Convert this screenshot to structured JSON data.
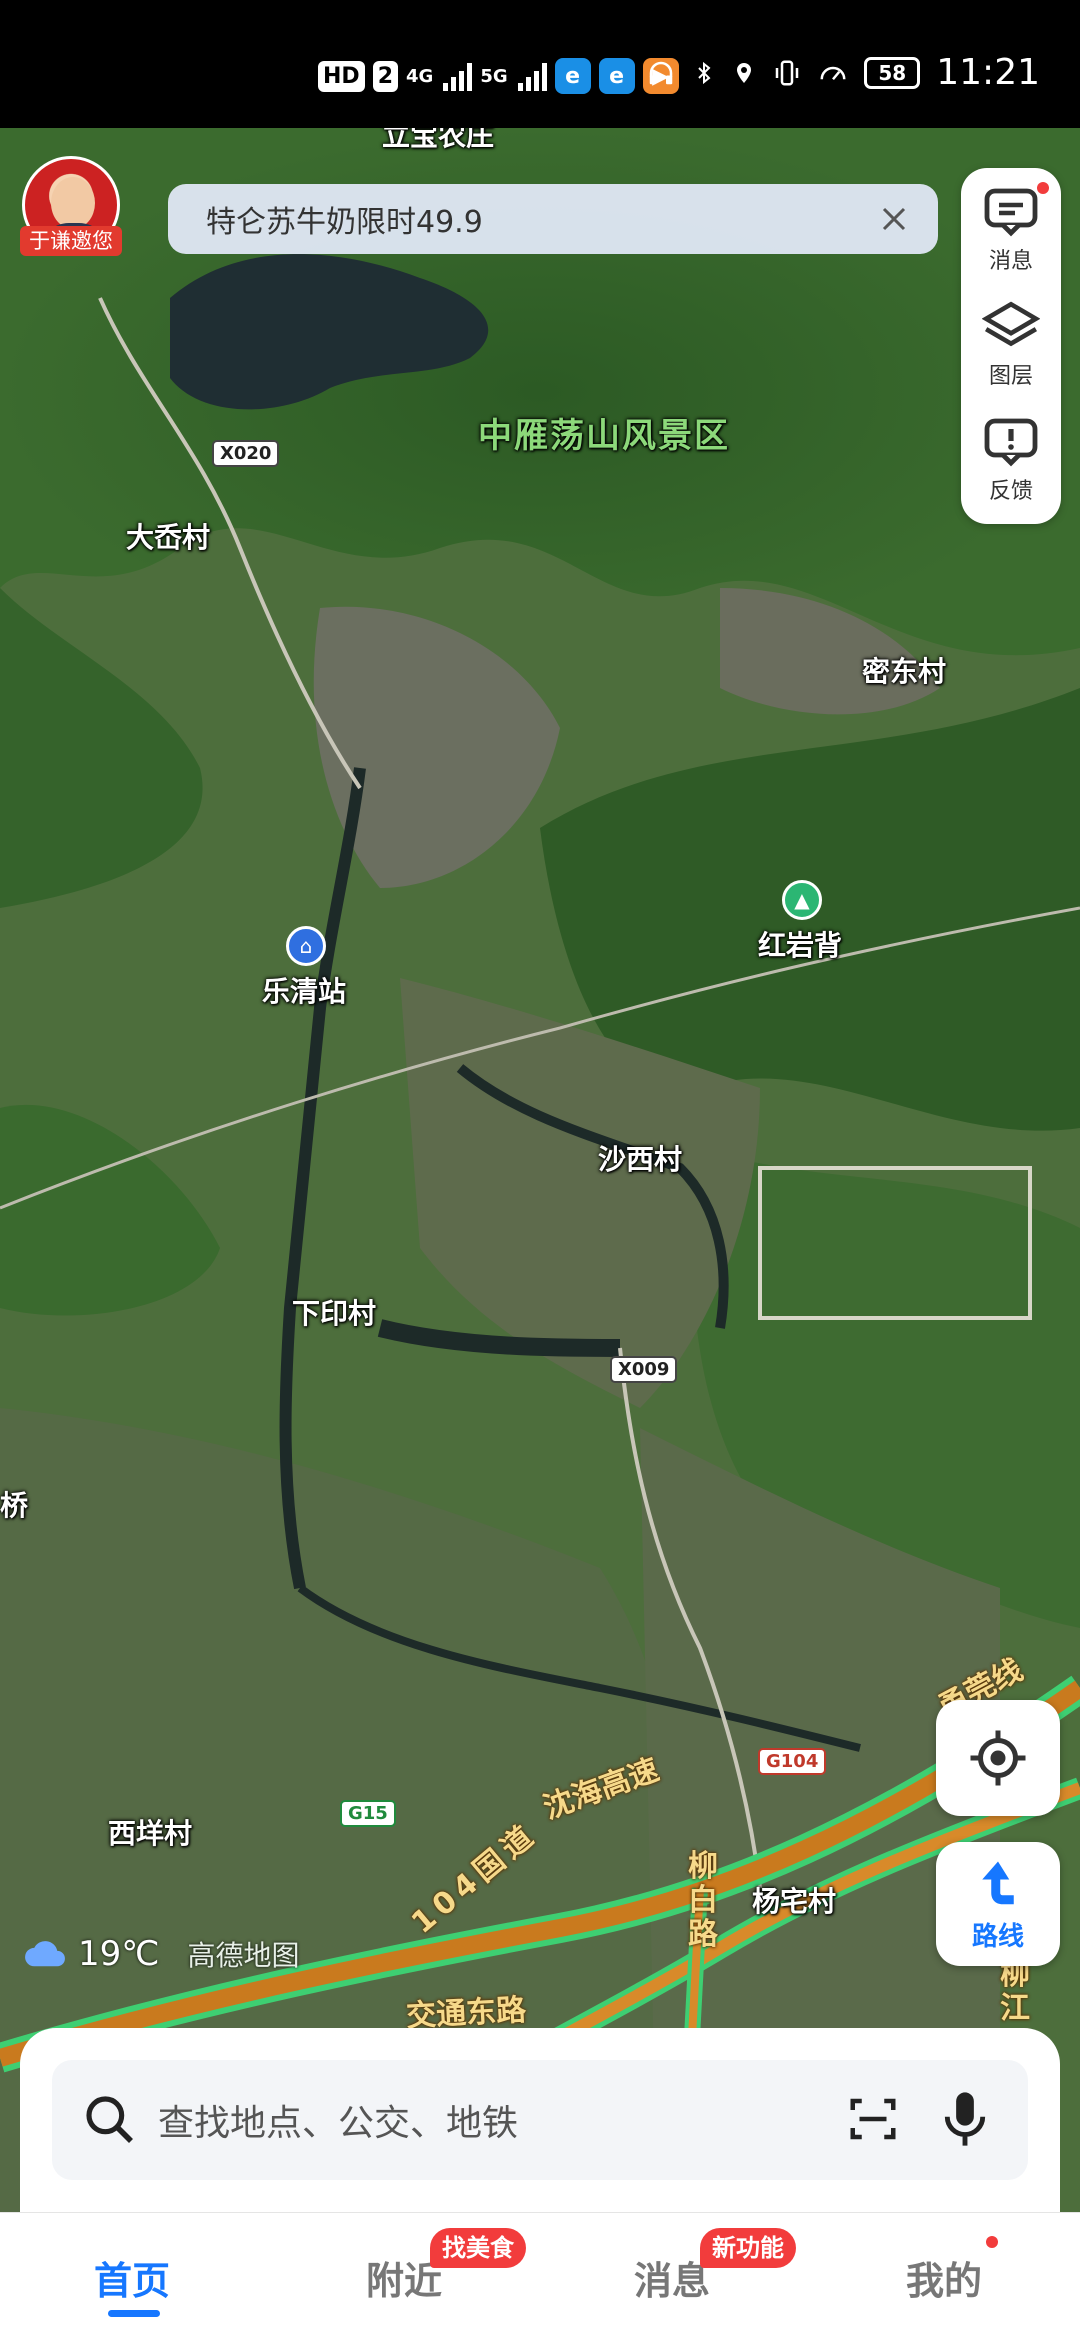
{
  "status_bar": {
    "left_chips": [
      "HD",
      "2"
    ],
    "signal_1": "4G",
    "signal_2": "5G",
    "battery": "58",
    "time": "11:21",
    "icons": [
      "headphones-icon",
      "bluetooth-icon",
      "location-icon",
      "vibrate-icon",
      "speedometer-icon"
    ]
  },
  "avatar": {
    "tag": "于谦邀您"
  },
  "promo": {
    "text": "特仑苏牛奶限时49.9"
  },
  "side_tools": {
    "messages": "消息",
    "layers": "图层",
    "feedback": "反馈"
  },
  "map": {
    "labels": {
      "top_village": "立宝农庄",
      "scenic": "中雁荡山风景区",
      "daxian": "大岙村",
      "midong": "密东村",
      "hongyanbei": "红岩背",
      "station": "乐清站",
      "shaxi": "沙西村",
      "xiayin": "下印村",
      "qiao": "桥",
      "xiyang": "西垟村",
      "yangzhai": "杨宅村"
    },
    "roads": {
      "x020": "X020",
      "x009": "X009",
      "g15": "G15",
      "g104": "G104",
      "shenhai": "沈海高速",
      "guodao": "104国道",
      "liubai": "柳白路",
      "jiaotong": "交通东路",
      "yongzhen": "甬莞线",
      "liujiang": "柳江"
    }
  },
  "weather": {
    "temp": "19℃",
    "brand": "高德地图"
  },
  "route_button": {
    "label": "路线"
  },
  "search": {
    "placeholder": "查找地点、公交、地铁"
  },
  "tabs": [
    {
      "label": "首页",
      "active": true
    },
    {
      "label": "附近",
      "badge": "找美食"
    },
    {
      "label": "消息",
      "badge": "新功能"
    },
    {
      "label": "我的"
    }
  ],
  "colors": {
    "accent": "#1677ff",
    "badge": "#f23c3c",
    "highway": "#c97a1e"
  }
}
